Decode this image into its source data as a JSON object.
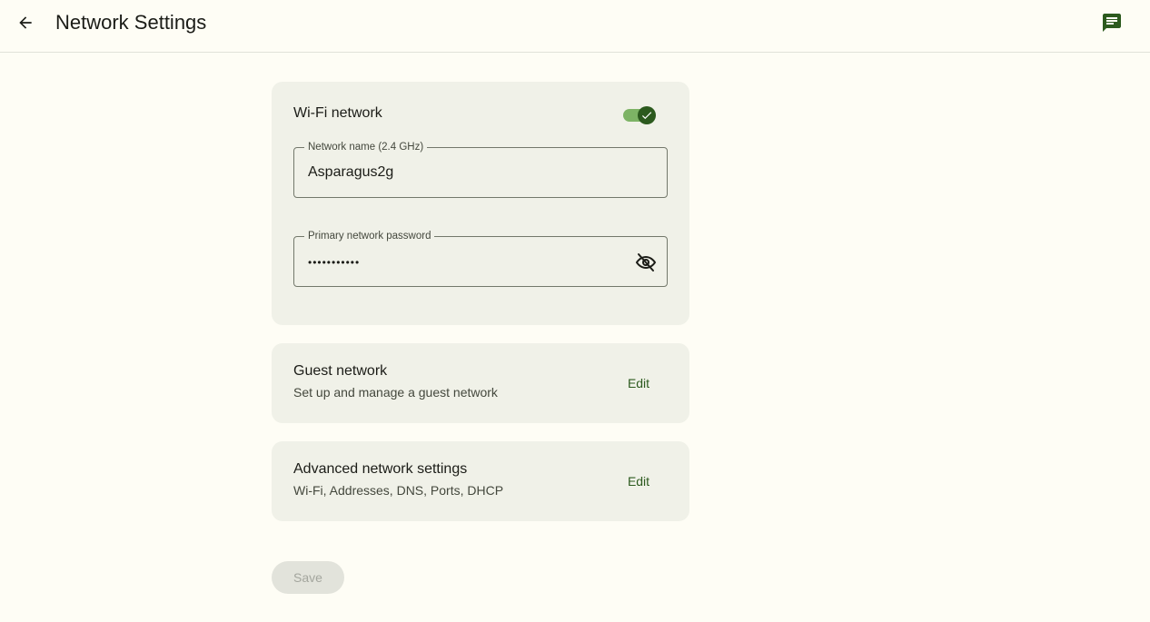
{
  "header": {
    "title": "Network Settings",
    "back_icon": "arrow-left-icon",
    "feedback_icon": "feedback-message-icon",
    "accent_color": "#2c5a1e"
  },
  "wifi": {
    "title": "Wi-Fi network",
    "enabled": true,
    "network_name": {
      "label": "Network name (2.4 GHz)",
      "value": "Asparagus2g"
    },
    "password": {
      "label": "Primary network password",
      "value": "•••••••••••",
      "visibility_icon": "eye-off-icon"
    }
  },
  "guest": {
    "title": "Guest network",
    "subtitle": "Set up and manage a guest network",
    "action_label": "Edit"
  },
  "advanced": {
    "title": "Advanced network settings",
    "subtitle": "Wi-Fi, Addresses, DNS, Ports, DHCP",
    "action_label": "Edit"
  },
  "footer": {
    "save_label": "Save",
    "save_disabled": true
  }
}
